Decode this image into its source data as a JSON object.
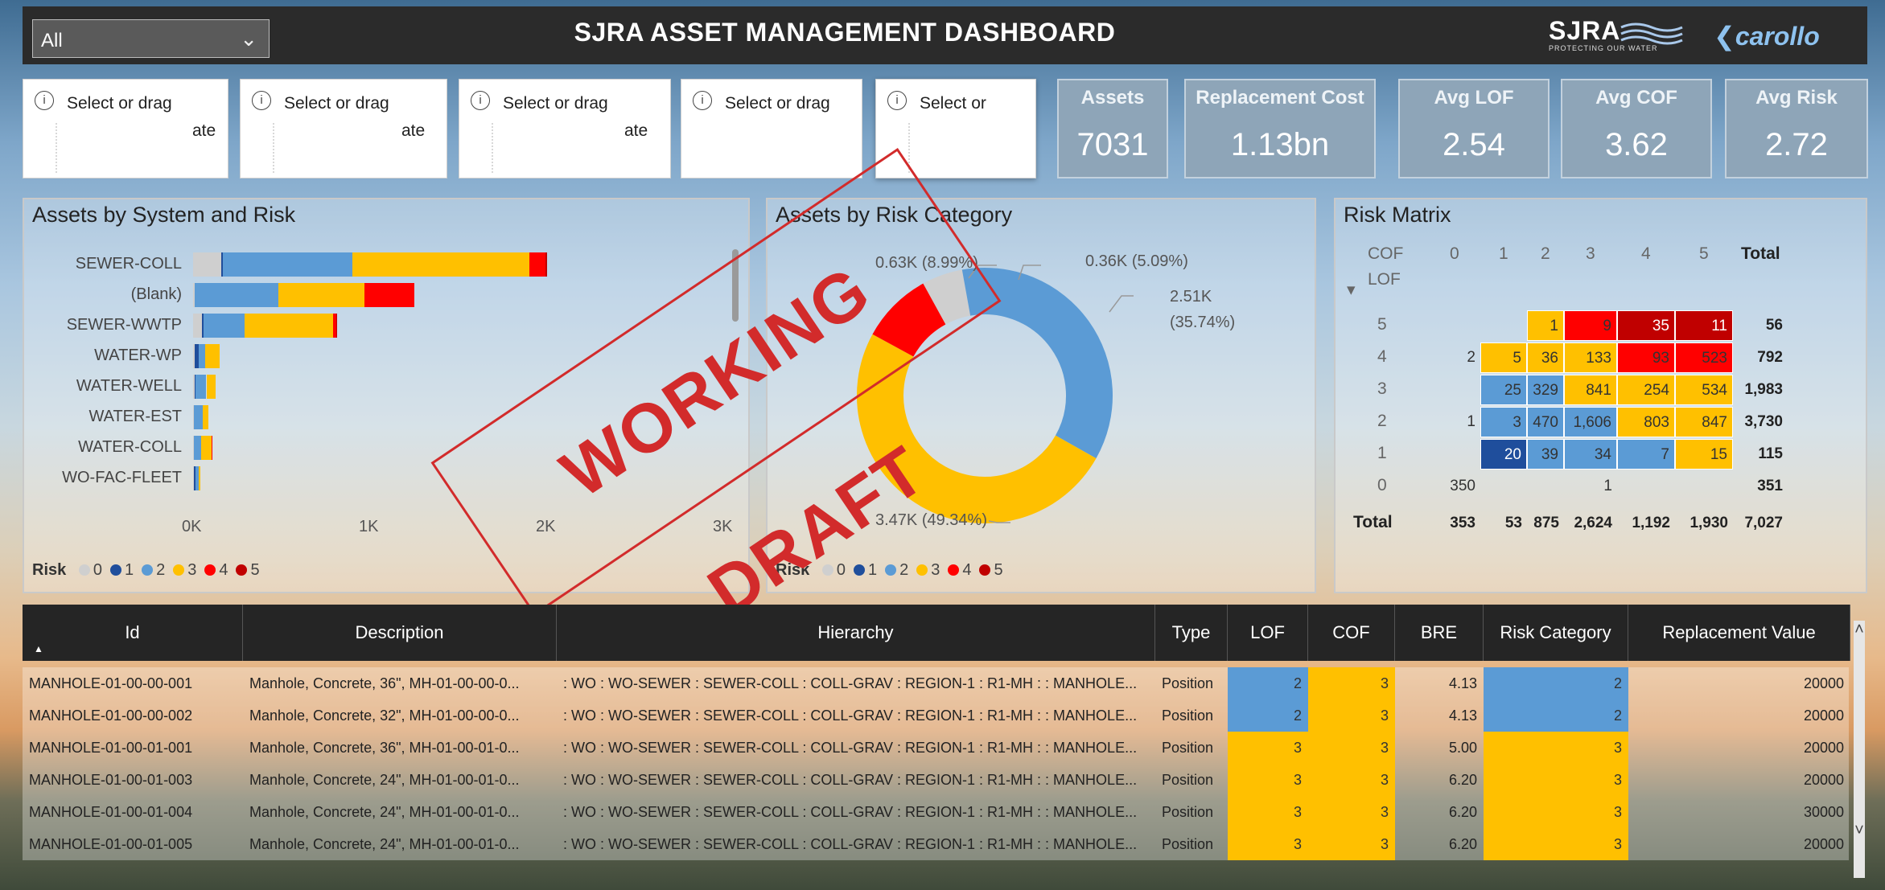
{
  "header": {
    "filter_value": "All",
    "title": "SJRA ASSET MANAGEMENT DASHBOARD",
    "logo_sjra": "SJRA",
    "logo_sjra_tagline": "PROTECTING OUR WATER",
    "logo_carollo": "carollo"
  },
  "slicers": [
    {
      "label": "Select or drag",
      "suffix": "ate"
    },
    {
      "label": "Select or drag",
      "suffix": "ate"
    },
    {
      "label": "Select or drag",
      "suffix": "ate"
    },
    {
      "label": "Select or drag",
      "suffix": ""
    },
    {
      "label": "Select or",
      "suffix": ""
    }
  ],
  "kpis": {
    "assets": {
      "title": "Assets",
      "value": "7031"
    },
    "replacement_cost": {
      "title": "Replacement Cost",
      "value": "1.13bn"
    },
    "avg_lof": {
      "title": "Avg LOF",
      "value": "2.54"
    },
    "avg_cof": {
      "title": "Avg COF",
      "value": "3.62"
    },
    "avg_risk": {
      "title": "Avg Risk",
      "value": "2.72"
    }
  },
  "risk_colors": {
    "0": "#cfcfcf",
    "1": "#1f4e9c",
    "2": "#5b9bd5",
    "3": "#ffc000",
    "4": "#ff0000",
    "5": "#c00000"
  },
  "chart_data": [
    {
      "type": "bar",
      "title": "Assets by System and Risk",
      "orientation": "horizontal",
      "stacked": true,
      "categories": [
        "SEWER-COLL",
        "(Blank)",
        "SEWER-WWTP",
        "WATER-WP",
        "WATER-WELL",
        "WATER-EST",
        "WATER-COLL",
        "WO-FAC-FLEET"
      ],
      "series": [
        {
          "name": "0",
          "values": [
            160,
            10,
            50,
            10,
            10,
            5,
            5,
            5
          ]
        },
        {
          "name": "1",
          "values": [
            10,
            0,
            10,
            20,
            5,
            0,
            0,
            10
          ]
        },
        {
          "name": "2",
          "values": [
            730,
            470,
            230,
            40,
            60,
            50,
            40,
            15
          ]
        },
        {
          "name": "3",
          "values": [
            1000,
            490,
            500,
            80,
            50,
            30,
            60,
            10
          ]
        },
        {
          "name": "4",
          "values": [
            90,
            280,
            20,
            0,
            0,
            0,
            5,
            0
          ]
        },
        {
          "name": "5",
          "values": [
            10,
            0,
            5,
            0,
            0,
            0,
            0,
            0
          ]
        }
      ],
      "xticks": [
        "0K",
        "1K",
        "2K",
        "3K"
      ],
      "xlim": [
        0,
        3000
      ],
      "legend_title": "Risk",
      "legend_labels": [
        "0",
        "1",
        "2",
        "3",
        "4",
        "5"
      ]
    },
    {
      "type": "pie",
      "donut": true,
      "title": "Assets by Risk Category",
      "slices": [
        {
          "name": "0",
          "value": 0.36,
          "label": "0.36K (5.09%)"
        },
        {
          "name": "2",
          "value": 2.51,
          "label": "2.51K (35.74%)"
        },
        {
          "name": "3",
          "value": 3.47,
          "label": "3.47K (49.34%)"
        },
        {
          "name": "4",
          "value": 0.63,
          "label": "0.63K (8.99%)"
        }
      ],
      "label_2_line1": "2.51K",
      "label_2_line2": "(35.74%)",
      "label_4_visible": "0.63K (8.99%)",
      "legend_title": "Risk",
      "legend_labels": [
        "0",
        "1",
        "2",
        "3",
        "4",
        "5"
      ]
    },
    {
      "type": "heatmap",
      "title": "Risk Matrix",
      "col_header": "COF",
      "row_header": "LOF",
      "columns": [
        "0",
        "1",
        "2",
        "3",
        "4",
        "5",
        "Total"
      ],
      "rows": [
        {
          "lof": "5",
          "cells": [
            "",
            "",
            "1",
            "9",
            "35",
            "11"
          ],
          "risk": [
            "",
            "",
            "3",
            "4",
            "5",
            "5"
          ],
          "total": "56"
        },
        {
          "lof": "4",
          "cells": [
            "2",
            "5",
            "36",
            "133",
            "93",
            "523"
          ],
          "risk": [
            "",
            "3",
            "3",
            "3",
            "4",
            "4"
          ],
          "total": "792"
        },
        {
          "lof": "3",
          "cells": [
            "",
            "25",
            "329",
            "841",
            "254",
            "534"
          ],
          "risk": [
            "",
            "2",
            "2",
            "3",
            "3",
            "3"
          ],
          "total": "1,983"
        },
        {
          "lof": "2",
          "cells": [
            "1",
            "3",
            "470",
            "1,606",
            "803",
            "847"
          ],
          "risk": [
            "",
            "2",
            "2",
            "2",
            "3",
            "3"
          ],
          "total": "3,730"
        },
        {
          "lof": "1",
          "cells": [
            "",
            "20",
            "39",
            "34",
            "7",
            "15"
          ],
          "risk": [
            "",
            "1",
            "2",
            "2",
            "2",
            "3"
          ],
          "total": "115"
        },
        {
          "lof": "0",
          "cells": [
            "350",
            "",
            "",
            "1",
            "",
            ""
          ],
          "risk": [
            "",
            "",
            "",
            "",
            "",
            ""
          ],
          "total": "351"
        }
      ],
      "totals_label": "Total",
      "totals": [
        "353",
        "53",
        "875",
        "2,624",
        "1,192",
        "1,930",
        "7,027"
      ]
    }
  ],
  "watermark": "WORKING DRAFT",
  "table": {
    "headers": [
      "Id",
      "Description",
      "Hierarchy",
      "Type",
      "LOF",
      "COF",
      "BRE",
      "Risk Category",
      "Replacement Value"
    ],
    "rows": [
      {
        "id": "MANHOLE-01-00-00-001",
        "desc": "Manhole, Concrete, 36\", MH-01-00-00-0...",
        "hier": ": WO : WO-SEWER : SEWER-COLL : COLL-GRAV : REGION-1 : R1-MH : : MANHOLE...",
        "type": "Position",
        "lof": "2",
        "cof": "3",
        "bre": "4.13",
        "risk": "2",
        "value": "20000"
      },
      {
        "id": "MANHOLE-01-00-00-002",
        "desc": "Manhole, Concrete, 32\", MH-01-00-00-0...",
        "hier": ": WO : WO-SEWER : SEWER-COLL : COLL-GRAV : REGION-1 : R1-MH : : MANHOLE...",
        "type": "Position",
        "lof": "2",
        "cof": "3",
        "bre": "4.13",
        "risk": "2",
        "value": "20000"
      },
      {
        "id": "MANHOLE-01-00-01-001",
        "desc": "Manhole, Concrete, 36\", MH-01-00-01-0...",
        "hier": ": WO : WO-SEWER : SEWER-COLL : COLL-GRAV : REGION-1 : R1-MH : : MANHOLE...",
        "type": "Position",
        "lof": "3",
        "cof": "3",
        "bre": "5.00",
        "risk": "3",
        "value": "20000"
      },
      {
        "id": "MANHOLE-01-00-01-003",
        "desc": "Manhole, Concrete, 24\", MH-01-00-01-0...",
        "hier": ": WO : WO-SEWER : SEWER-COLL : COLL-GRAV : REGION-1 : R1-MH : : MANHOLE...",
        "type": "Position",
        "lof": "3",
        "cof": "3",
        "bre": "6.20",
        "risk": "3",
        "value": "20000"
      },
      {
        "id": "MANHOLE-01-00-01-004",
        "desc": "Manhole, Concrete, 24\", MH-01-00-01-0...",
        "hier": ": WO : WO-SEWER : SEWER-COLL : COLL-GRAV : REGION-1 : R1-MH : : MANHOLE...",
        "type": "Position",
        "lof": "3",
        "cof": "3",
        "bre": "6.20",
        "risk": "3",
        "value": "30000"
      },
      {
        "id": "MANHOLE-01-00-01-005",
        "desc": "Manhole, Concrete, 24\", MH-01-00-01-0...",
        "hier": ": WO : WO-SEWER : SEWER-COLL : COLL-GRAV : REGION-1 : R1-MH : : MANHOLE...",
        "type": "Position",
        "lof": "3",
        "cof": "3",
        "bre": "6.20",
        "risk": "3",
        "value": "20000"
      }
    ]
  }
}
